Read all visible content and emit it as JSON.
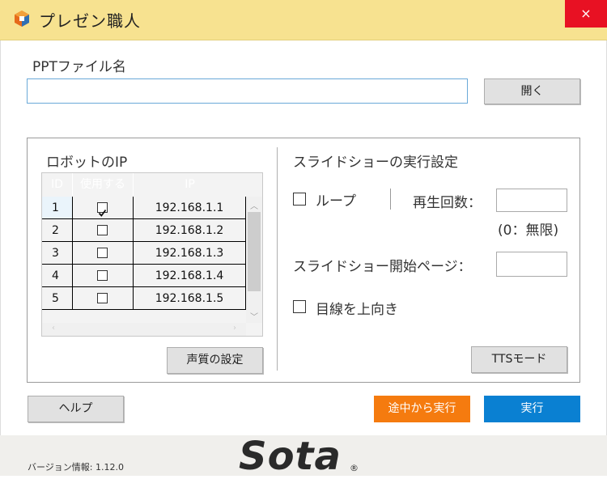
{
  "window": {
    "title": "プレゼン職人",
    "close_glyph": "×"
  },
  "ppt": {
    "label": "PPTファイル名",
    "value": "",
    "open_button": "開く"
  },
  "robot": {
    "title": "ロボットのIP",
    "columns": [
      "ID",
      "使用する",
      "IP"
    ],
    "rows": [
      {
        "id": "1",
        "checked": true,
        "ip": "192.168.1.1"
      },
      {
        "id": "2",
        "checked": false,
        "ip": "192.168.1.2"
      },
      {
        "id": "3",
        "checked": false,
        "ip": "192.168.1.3"
      },
      {
        "id": "4",
        "checked": false,
        "ip": "192.168.1.4"
      },
      {
        "id": "5",
        "checked": false,
        "ip": "192.168.1.5"
      }
    ],
    "voice_button": "声質の設定"
  },
  "slideshow": {
    "title": "スライドショーの実行設定",
    "loop_label": "ループ",
    "repeat_label": "再生回数：",
    "repeat_value": "",
    "repeat_hint": "(0：無限)",
    "start_page_label": "スライドショー開始ページ：",
    "start_page_value": "",
    "gaze_label": "目線を上向き",
    "tts_button": "TTSモード"
  },
  "actions": {
    "help": "ヘルプ",
    "resume": "途中から実行",
    "run": "実行"
  },
  "colors": {
    "resume_bg": "#f57b0f",
    "run_bg": "#0a80d2",
    "titlebar": "#f7e290"
  },
  "footer": {
    "version": "バージョン情報: 1.12.0",
    "logo": "Sota",
    "registered": "®"
  }
}
